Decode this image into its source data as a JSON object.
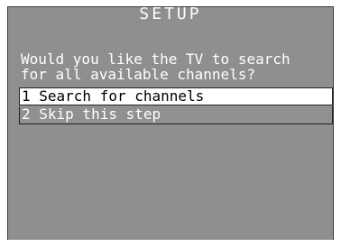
{
  "screen": {
    "title": "SETUP",
    "prompt_line1": "Would you like the TV to search",
    "prompt_line2": "for all available channels?"
  },
  "menu": {
    "items": [
      {
        "label": "1 Search for channels",
        "selected": true
      },
      {
        "label": "2 Skip this step",
        "selected": false
      }
    ]
  },
  "colors": {
    "panel_bg": "#8f8f8f",
    "text": "#ffffff",
    "highlight_bg": "#ffffff",
    "highlight_text": "#000000"
  }
}
